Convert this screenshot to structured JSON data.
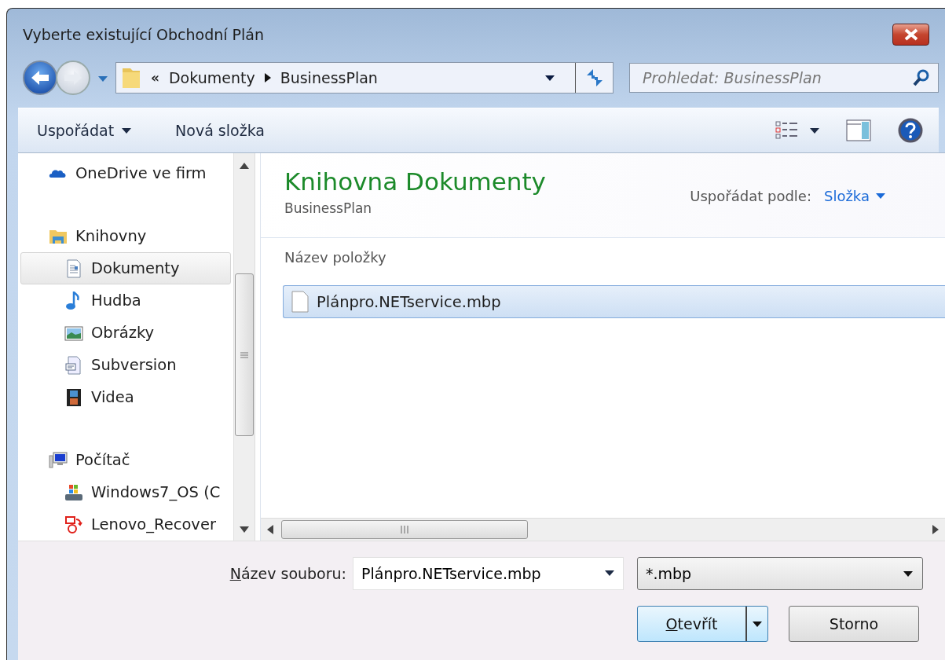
{
  "window": {
    "title": "Vyberte existující Obchodní Plán"
  },
  "address": {
    "overflow": "«",
    "crumbs": [
      "Dokumenty",
      "BusinessPlan"
    ]
  },
  "search": {
    "placeholder": "Prohledat: BusinessPlan"
  },
  "toolbar": {
    "items": [
      {
        "label": "Uspořádat",
        "kind": "menu"
      },
      {
        "label": "Nová složka",
        "kind": "command"
      }
    ]
  },
  "sidebar": {
    "items": [
      {
        "label": "OneDrive ve firm",
        "kind": "cloud",
        "selected": false
      },
      {
        "label": "Knihovny",
        "kind": "library",
        "selected": false,
        "children": [
          {
            "label": "Dokumenty",
            "kind": "document",
            "selected": true
          },
          {
            "label": "Hudba",
            "kind": "music",
            "selected": false
          },
          {
            "label": "Obrázky",
            "kind": "pictures",
            "selected": false
          },
          {
            "label": "Subversion",
            "kind": "subversion",
            "selected": false
          },
          {
            "label": "Videa",
            "kind": "video",
            "selected": false
          }
        ]
      },
      {
        "label": "Počítač",
        "kind": "computer",
        "selected": false,
        "children": [
          {
            "label": "Windows7_OS (C",
            "kind": "drive",
            "selected": false
          },
          {
            "label": "Lenovo_Recover",
            "kind": "recovery",
            "selected": false
          }
        ]
      }
    ]
  },
  "library": {
    "title": "Knihovna Dokumenty",
    "subtitle": "BusinessPlan",
    "arrange_label": "Uspořádat podle:",
    "arrange_value": "Složka"
  },
  "list": {
    "column": "Název položky",
    "files": [
      {
        "name": "Plánpro.NETservice.mbp",
        "selected": true
      }
    ]
  },
  "file_name": {
    "label": "Název souboru:",
    "value": "Plánpro.NETservice.mbp"
  },
  "file_type": {
    "value": "*.mbp"
  },
  "buttons": [
    {
      "label": "Otevřít",
      "kind": "split"
    },
    {
      "label": "Storno",
      "kind": "plain"
    }
  ]
}
